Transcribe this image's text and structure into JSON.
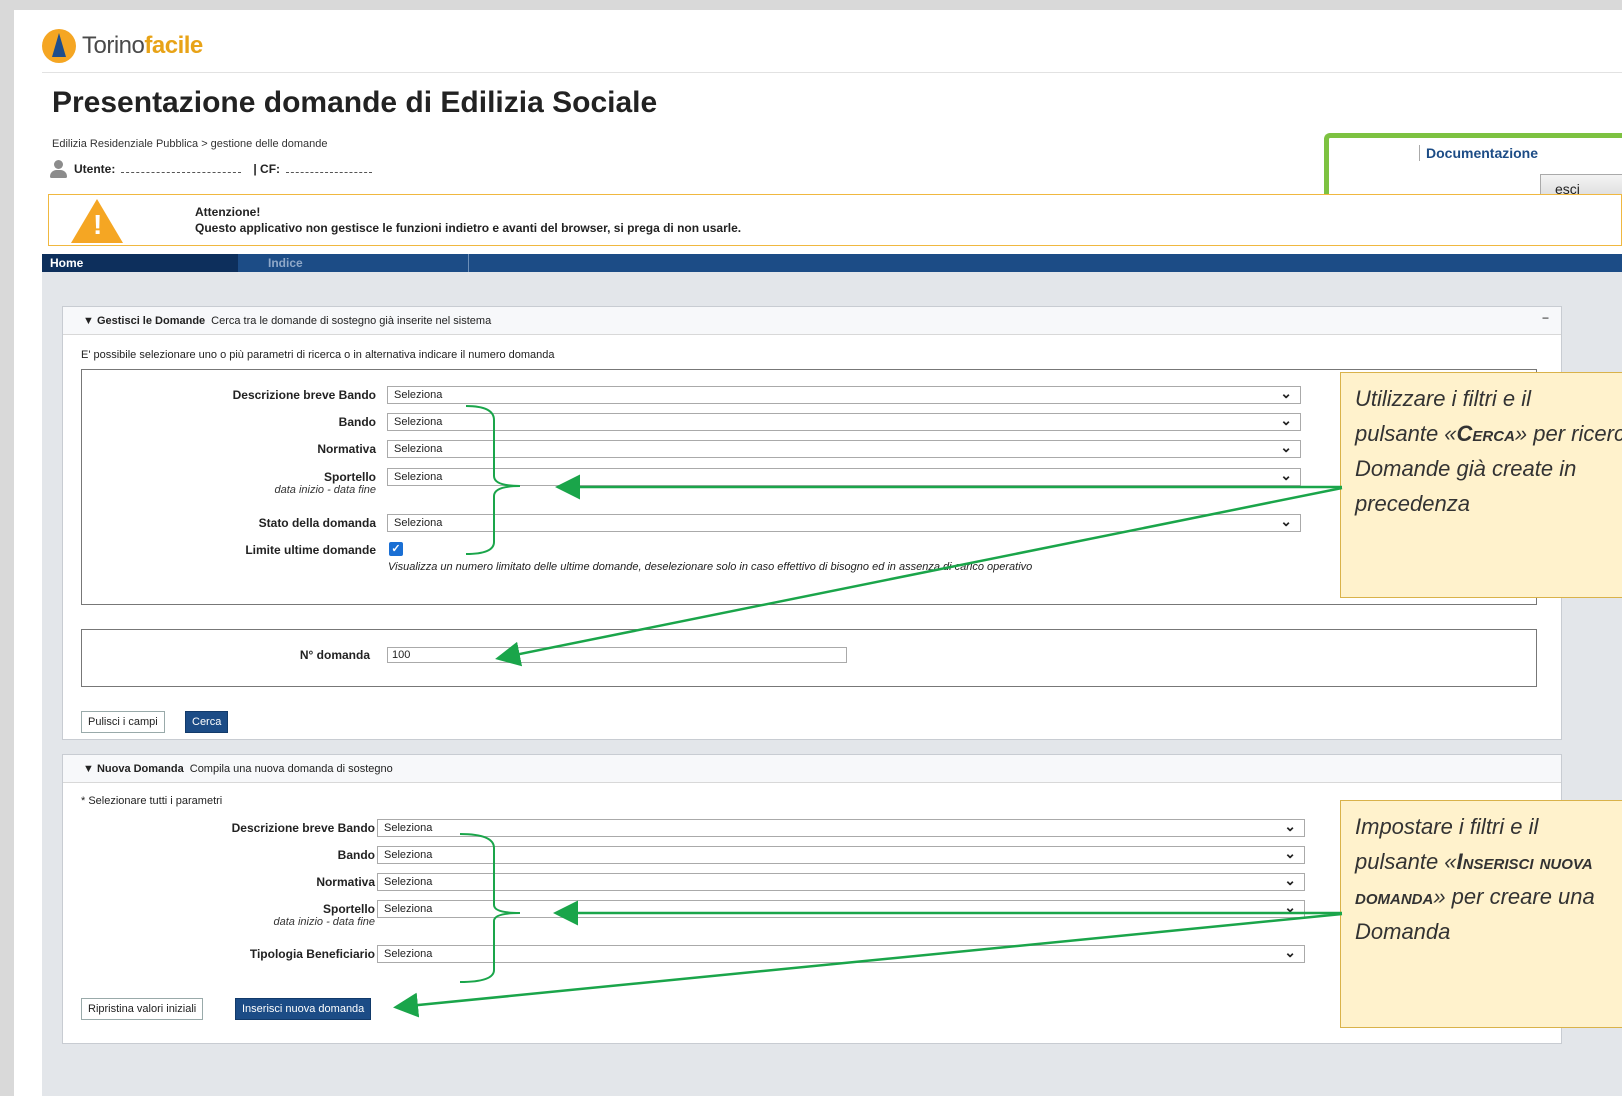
{
  "header": {
    "logo_plain": "Torino",
    "logo_accent": "facile",
    "title": "Presentazione domande di Edilizia Sociale",
    "breadcrumb": "Edilizia Residenziale Pubblica > gestione delle domande",
    "user_label": "Utente:",
    "cf_label": "| CF:",
    "documentation_link": "Documentazione",
    "exit_button": "esci"
  },
  "warning": {
    "title": "Attenzione!",
    "text": "Questo applicativo non gestisce le funzioni indietro e avanti del browser, si prega di non usarle."
  },
  "nav": {
    "home": "Home",
    "index": "Indice"
  },
  "search_panel": {
    "header_title": "▼ Gestisci le Domande",
    "header_desc": "Cerca tra le domande di sostegno già inserite nel sistema",
    "collapse": "−",
    "note": "E' possibile selezionare uno o più parametri di ricerca o in alternativa indicare il numero domanda",
    "fields": {
      "descrizione_label": "Descrizione breve Bando",
      "descrizione_value": "Seleziona",
      "bando_label": "Bando",
      "bando_value": "Seleziona",
      "normativa_label": "Normativa",
      "normativa_value": "Seleziona",
      "sportello_label": "Sportello",
      "sportello_sub": "data inizio - data fine",
      "sportello_value": "Seleziona",
      "stato_label": "Stato della domanda",
      "stato_value": "Seleziona",
      "limite_label": "Limite ultime domande",
      "limite_checked": true,
      "limite_hint": "Visualizza un numero limitato delle ultime domande, deselezionare solo in caso effettivo di bisogno ed in assenza di carico operativo"
    },
    "numero_label": "N° domanda",
    "numero_value": "100",
    "clear_button": "Pulisci i campi",
    "search_button": "Cerca"
  },
  "new_panel": {
    "header_title": "▼ Nuova Domanda",
    "header_desc": "Compila una nuova domanda di sostegno",
    "note": "* Selezionare tutti i parametri",
    "fields": {
      "descrizione_label": "Descrizione breve Bando",
      "descrizione_value": "Seleziona",
      "bando_label": "Bando",
      "bando_value": "Seleziona",
      "normativa_label": "Normativa",
      "normativa_value": "Seleziona",
      "sportello_label": "Sportello",
      "sportello_sub": "data inizio - data fine",
      "sportello_value": "Seleziona",
      "tipologia_label": "Tipologia Beneficiario",
      "tipologia_value": "Seleziona"
    },
    "reset_button": "Ripristina valori iniziali",
    "insert_button": "Inserisci nuova domanda"
  },
  "callouts": {
    "search_line1": "Utilizzare i filtri e il",
    "search_line2_pre": "pulsante «",
    "search_line2_sc": "Cerca",
    "search_line2_post": "» per ricercare le",
    "search_line3": "Domande già create in",
    "search_line4": "precedenza",
    "new_line1": "Impostare i filtri e il",
    "new_line2_pre": "pulsante «",
    "new_line2_sc": "Inserisci nuova",
    "new_line3_sc": "domanda",
    "new_line3_post": "» per creare una",
    "new_line4": "Domanda"
  },
  "colors": {
    "nav_blue": "#1c4c86",
    "highlight_green": "#7dc241",
    "arrow_green": "#1aa54a",
    "warning_orange": "#f5a623",
    "callout_bg": "#fff2cc"
  }
}
